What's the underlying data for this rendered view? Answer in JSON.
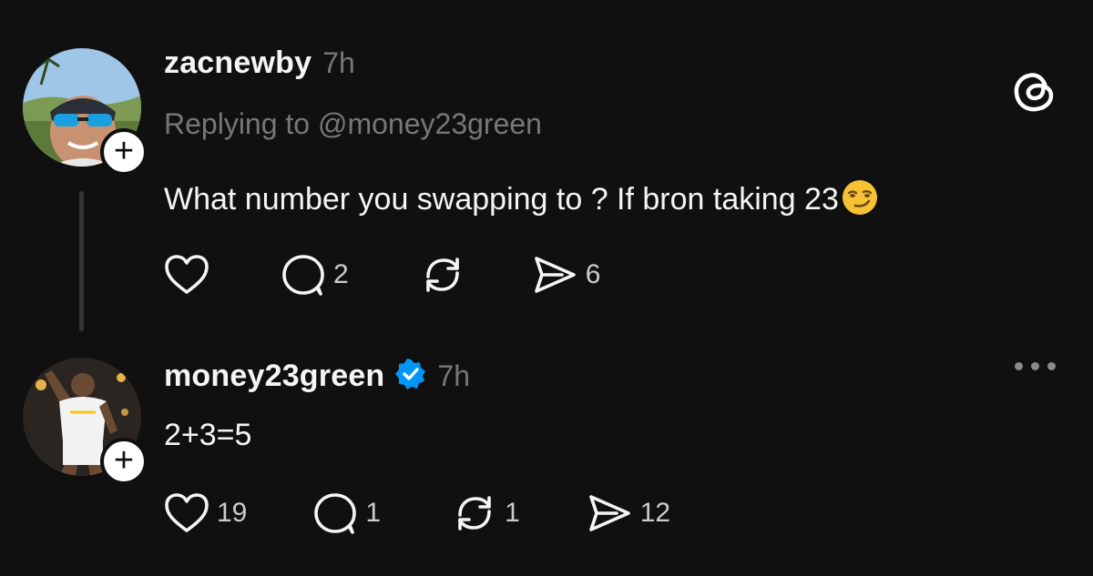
{
  "reply_post": {
    "username": "zacnewby",
    "time": "7h",
    "replying_prefix": "Replying to ",
    "replying_handle": "@money23green",
    "text": "What number you swapping to ? If bron taking 23",
    "emoji": "smirking-face-emoji",
    "likes": "",
    "comments": "2",
    "reposts": "",
    "shares": "6"
  },
  "main_post": {
    "username": "money23green",
    "verified": true,
    "time": "7h",
    "text": "2+3=5",
    "likes": "19",
    "comments": "1",
    "reposts": "1",
    "shares": "12"
  },
  "icons": {
    "app_logo": "threads-logo-icon",
    "like": "heart-icon",
    "comment": "comment-bubble-icon",
    "repost": "repost-icon",
    "share": "send-icon",
    "follow": "plus-icon",
    "more": "more-options-icon"
  },
  "colors": {
    "background": "#101010",
    "text_primary": "#f3f5f7",
    "text_secondary": "#777777",
    "verified_badge": "#0095f6"
  }
}
